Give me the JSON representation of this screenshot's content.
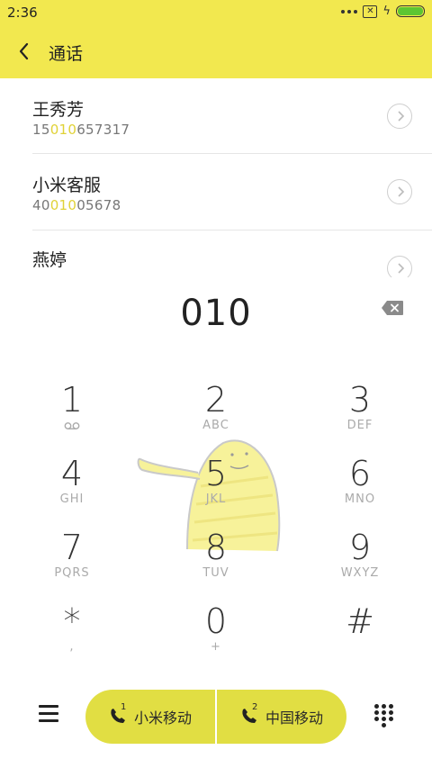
{
  "status_bar": {
    "time": "2:36"
  },
  "app_bar": {
    "title": "通话"
  },
  "contacts": [
    {
      "name": "王秀芳",
      "number_pre": "15",
      "number_match": "010",
      "number_post": "657317"
    },
    {
      "name": "小米客服",
      "number_pre": "40",
      "number_match": "010",
      "number_post": "05678"
    },
    {
      "name": "燕婷",
      "number_pre": "",
      "number_match": "",
      "number_post": ""
    }
  ],
  "dialer": {
    "input": "010",
    "keys": [
      {
        "digit": "1",
        "letters": ""
      },
      {
        "digit": "2",
        "letters": "ABC"
      },
      {
        "digit": "3",
        "letters": "DEF"
      },
      {
        "digit": "4",
        "letters": "GHI"
      },
      {
        "digit": "5",
        "letters": "JKL"
      },
      {
        "digit": "6",
        "letters": "MNO"
      },
      {
        "digit": "7",
        "letters": "PQRS"
      },
      {
        "digit": "8",
        "letters": "TUV"
      },
      {
        "digit": "9",
        "letters": "WXYZ"
      },
      {
        "digit": "*",
        "letters": ","
      },
      {
        "digit": "0",
        "letters": "+"
      },
      {
        "digit": "#",
        "letters": ""
      }
    ]
  },
  "bottom_bar": {
    "sim1": {
      "index": "1",
      "label": "小米移动"
    },
    "sim2": {
      "index": "2",
      "label": "中国移动"
    }
  },
  "colors": {
    "accent": "#f2e84f",
    "call_button": "#e1de43",
    "match_highlight": "#e0d237"
  }
}
